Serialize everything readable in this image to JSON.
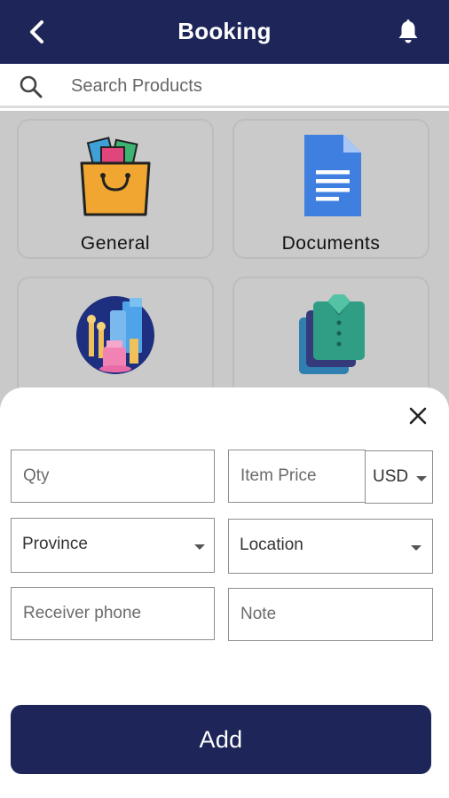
{
  "header": {
    "title": "Booking",
    "back_icon": "chevron-left-icon",
    "notification_icon": "bell-icon",
    "background_color": "#1e2559"
  },
  "search": {
    "placeholder": "Search Products",
    "icon": "search-icon"
  },
  "categories": [
    {
      "label": "General",
      "icon": "shopping-bag-icon"
    },
    {
      "label": "Documents",
      "icon": "document-icon"
    },
    {
      "label": "",
      "icon": "cosmetics-icon"
    },
    {
      "label": "",
      "icon": "clothes-icon"
    }
  ],
  "sheet": {
    "close_icon": "close-icon",
    "fields": {
      "qty": {
        "placeholder": "Qty"
      },
      "item_price": {
        "placeholder": "Item Price"
      },
      "currency": {
        "selected": "USD"
      },
      "province": {
        "selected": "Province"
      },
      "location": {
        "selected": "Location"
      },
      "receiver_phone": {
        "placeholder": "Receiver phone"
      },
      "note": {
        "placeholder": "Note"
      }
    },
    "add_label": "Add"
  },
  "colors": {
    "primary": "#1e2559",
    "overlay": "#c9c9c9"
  }
}
